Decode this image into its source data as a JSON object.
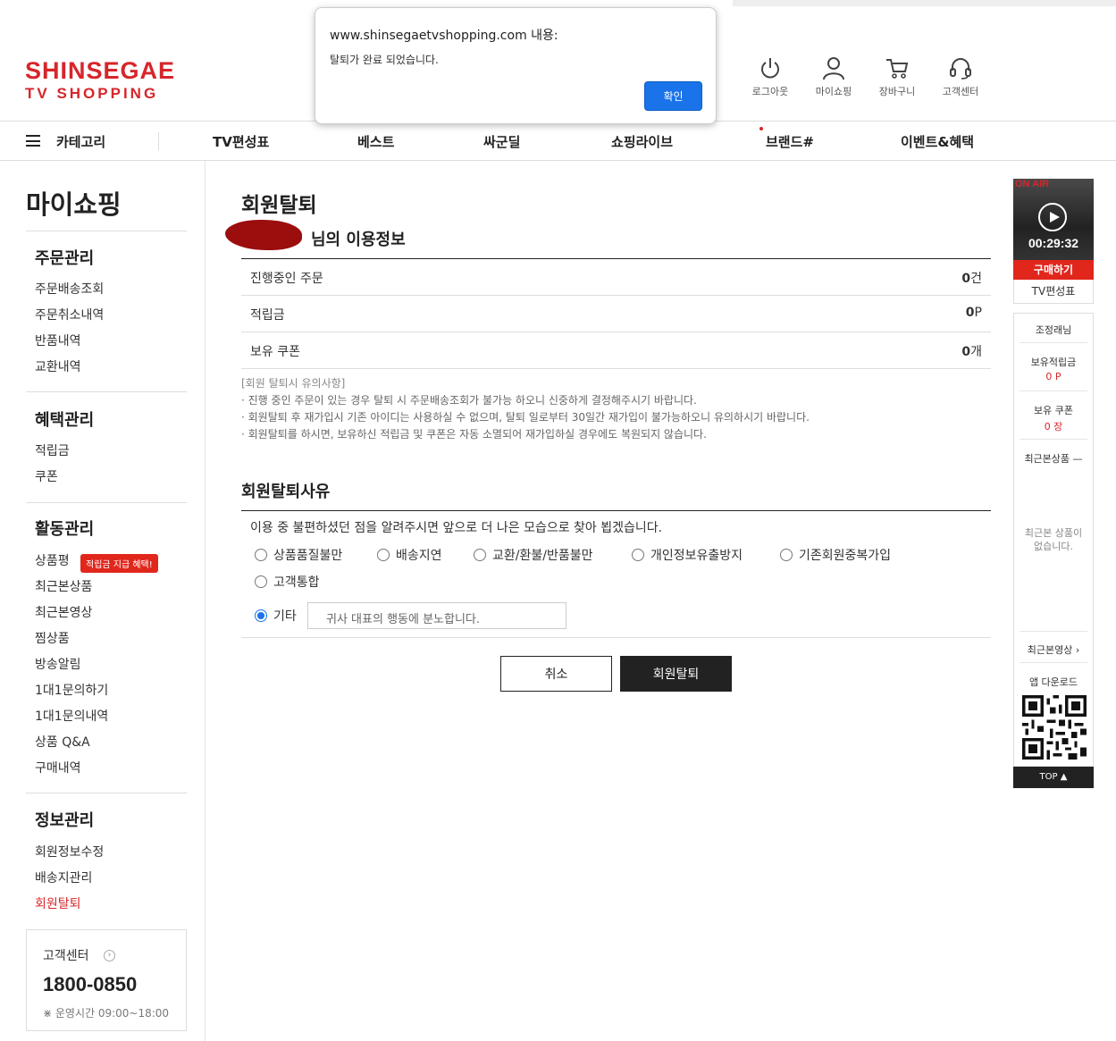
{
  "header": {
    "logo_line1": "SHINSEGAE",
    "logo_line2": "TV SHOPPING",
    "utils": [
      {
        "label": "로그아웃",
        "icon": "power-icon"
      },
      {
        "label": "마이쇼핑",
        "icon": "person-icon"
      },
      {
        "label": "장바구니",
        "icon": "cart-icon"
      },
      {
        "label": "고객센터",
        "icon": "headset-icon"
      }
    ]
  },
  "gnb": {
    "category": "카테고리",
    "menus": [
      "TV편성표",
      "베스트",
      "싸군딜",
      "쇼핑라이브",
      "브랜드#",
      "이벤트&혜택"
    ]
  },
  "sidebar": {
    "title": "마이쇼핑",
    "sections": [
      {
        "title": "주문관리",
        "items": [
          "주문배송조회",
          "주문취소내역",
          "반품내역",
          "교환내역"
        ]
      },
      {
        "title": "혜택관리",
        "items": [
          "적립금",
          "쿠폰"
        ]
      },
      {
        "title": "활동관리",
        "items": [
          "상품평",
          "최근본상품",
          "최근본영상",
          "찜상품",
          "방송알림",
          "1대1문의하기",
          "1대1문의내역",
          "상품 Q&A",
          "구매내역"
        ]
      },
      {
        "title": "정보관리",
        "items": [
          "회원정보수정",
          "배송지관리",
          "회원탈퇴"
        ]
      }
    ],
    "review_badge": "적립금 지급 혜택!",
    "cs": {
      "title": "고객센터",
      "phone": "1800-0850",
      "hours": "운영시간 09:00~18:00"
    }
  },
  "main": {
    "title": "회원탈퇴",
    "subtitle": "님의 이용정보",
    "info_rows": [
      {
        "label": "진행중인 주문",
        "value": "0",
        "unit": "건"
      },
      {
        "label": "적립금",
        "value": "0",
        "unit": "P"
      },
      {
        "label": "보유 쿠폰",
        "value": "0",
        "unit": "개"
      }
    ],
    "notice_title": "[회원 탈퇴시 유의사항]",
    "notices": [
      "· 진행 중인 주문이 있는 경우 탈퇴 시 주문배송조회가 불가능 하오니 신중하게 결정해주시기 바랍니다.",
      "· 회원탈퇴 후 재가입시 기존 아이디는 사용하실 수 없으며, 탈퇴 일로부터 30일간 재가입이 불가능하오니 유의하시기 바랍니다.",
      "· 회원탈퇴를 하시면, 보유하신 적립금 및 쿠폰은 자동 소멸되어 재가입하실 경우에도 복원되지 않습니다."
    ],
    "reason_title": "회원탈퇴사유",
    "reason_desc": "이용 중 불편하셨던 점을 알려주시면 앞으로 더 나은 모습으로 찾아 뵙겠습니다.",
    "reasons": [
      "상품품질불만",
      "배송지연",
      "교환/환불/반품불만",
      "개인정보유출방지",
      "기존회원중복가입",
      "고객통합",
      "기타"
    ],
    "selected_reason": "기타",
    "etc_value": "귀사 대표의 행동에 분노합니다.",
    "cancel_label": "취소",
    "submit_label": "회원탈퇴"
  },
  "quick": {
    "onair": "ON AIR",
    "time": "00:29:32",
    "buy": "구매하기",
    "schedule": "TV편성표",
    "user": "조정래님",
    "points_label": "보유적립금",
    "points_value": "0 P",
    "coupon_label": "보유 쿠폰",
    "coupon_value": "0 장",
    "recent_products": "최근본상품 —",
    "no_recent": "최근본 상품이 없습니다.",
    "recent_videos": "최근본영상 ›",
    "app_download": "앱 다운로드",
    "top": "TOP ▲"
  },
  "dialog": {
    "header": "www.shinsegaetvshopping.com 내용:",
    "message": "탈퇴가 완료 되었습니다.",
    "ok": "확인"
  },
  "colors": {
    "brand_red": "#d6262b",
    "dialog_blue": "#1a73e8"
  }
}
